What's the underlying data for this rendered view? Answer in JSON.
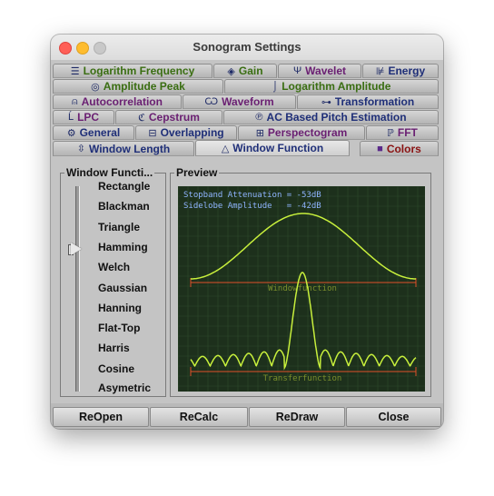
{
  "window": {
    "title": "Sonogram Settings"
  },
  "tabs": {
    "row1": [
      {
        "label": "Logarithm Frequency",
        "icon": "bars-icon"
      },
      {
        "label": "Gain",
        "icon": "gain-icon"
      },
      {
        "label": "Wavelet",
        "icon": "psi-icon"
      },
      {
        "label": "Energy",
        "icon": "energy-icon"
      }
    ],
    "row2": [
      {
        "label": "Amplitude Peak",
        "icon": "peak-icon"
      },
      {
        "label": "Logarithm Amplitude",
        "icon": "log-curve-icon"
      }
    ],
    "row3": [
      {
        "label": "Autocorrelation",
        "icon": "autocorr-icon"
      },
      {
        "label": "Waveform",
        "icon": "waveform-icon"
      },
      {
        "label": "Transformation",
        "icon": "transform-icon"
      }
    ],
    "row4": [
      {
        "label": "LPC",
        "icon": "lpc-icon"
      },
      {
        "label": "Cepstrum",
        "icon": "cepstrum-icon"
      },
      {
        "label": "AC Based Pitch Estimation",
        "icon": "pitch-icon"
      }
    ],
    "row5": [
      {
        "label": "General",
        "icon": "general-icon"
      },
      {
        "label": "Overlapping",
        "icon": "overlap-icon"
      },
      {
        "label": "Perspectogram",
        "icon": "perspecto-icon"
      },
      {
        "label": "FFT",
        "icon": "fft-icon"
      }
    ],
    "row6": [
      {
        "label": "Window Length",
        "icon": "window-length-icon"
      },
      {
        "label": "Window Function",
        "icon": "window-function-icon",
        "selected": true
      },
      {
        "label": "Colors",
        "icon": "colors-icon"
      }
    ]
  },
  "window_function": {
    "group_title": "Window Functi...",
    "options": [
      "Rectangle",
      "Blackman",
      "Triangle",
      "Hamming",
      "Welch",
      "Gaussian",
      "Hanning",
      "Flat-Top",
      "Harris",
      "Cosine",
      "Asymetric"
    ],
    "selected": "Hamming"
  },
  "preview": {
    "group_title": "Preview",
    "stopband_text": "Stopband Attenuation = -53dB",
    "sidelobe_text": "Sidelobe Amplitude   = -42dB",
    "window_label": "Windowfunction",
    "transfer_label": "Transferfunction",
    "colors": {
      "background": "#1d301c",
      "grid": "#2e4a2c",
      "curve": "#c8f03c",
      "axis": "#e0502a",
      "text": "#8fb4ff"
    }
  },
  "buttons": {
    "reopen": "ReOpen",
    "recalc": "ReCalc",
    "redraw": "ReDraw",
    "close": "Close"
  }
}
